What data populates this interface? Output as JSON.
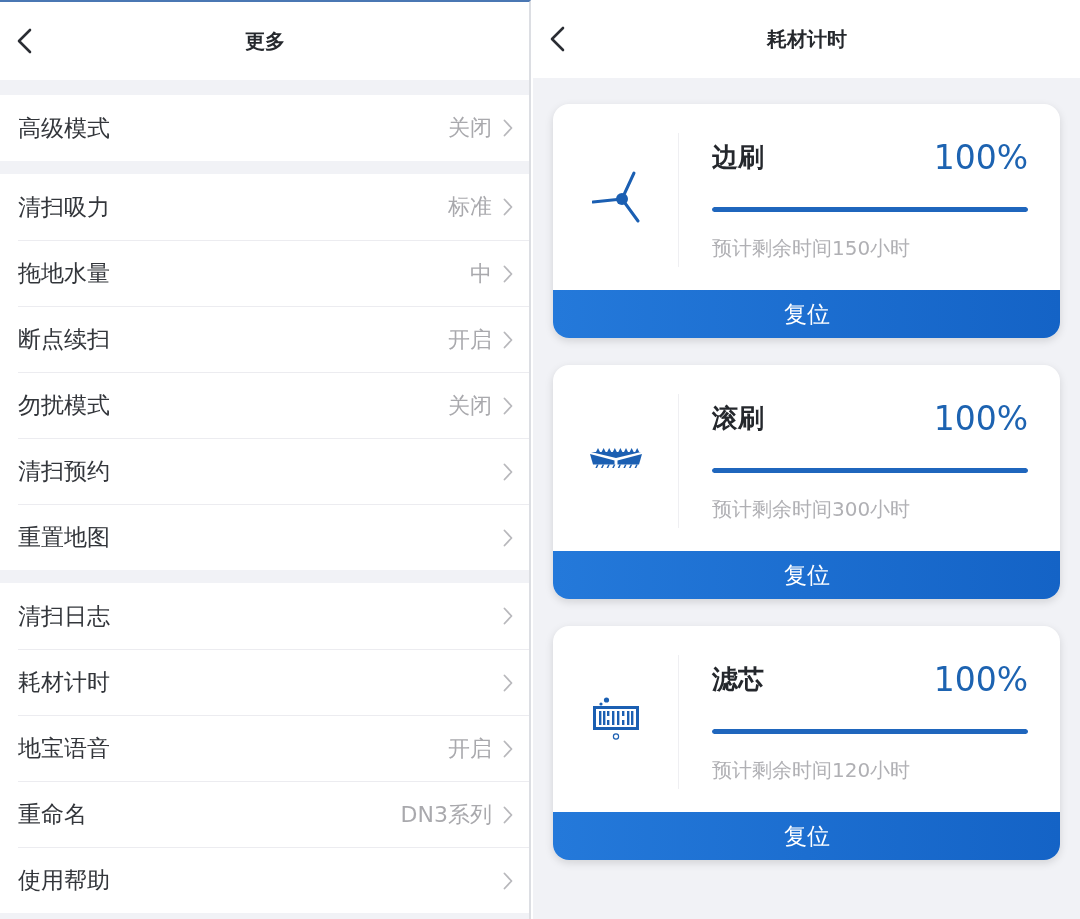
{
  "more_screen": {
    "title": "更多",
    "groups": [
      {
        "items": [
          {
            "label": "高级模式",
            "value": "关闭"
          }
        ]
      },
      {
        "items": [
          {
            "label": "清扫吸力",
            "value": "标准"
          },
          {
            "label": "拖地水量",
            "value": "中"
          },
          {
            "label": "断点续扫",
            "value": "开启"
          },
          {
            "label": "勿扰模式",
            "value": "关闭"
          },
          {
            "label": "清扫预约"
          },
          {
            "label": "重置地图"
          }
        ]
      },
      {
        "items": [
          {
            "label": "清扫日志"
          },
          {
            "label": "耗材计时"
          },
          {
            "label": "地宝语音",
            "value": "开启"
          },
          {
            "label": "重命名",
            "value": "DN3系列"
          },
          {
            "label": "使用帮助"
          }
        ]
      }
    ]
  },
  "consumables_screen": {
    "title": "耗材计时",
    "items": [
      {
        "kind": "side_brush",
        "name": "边刷",
        "percent": "100%",
        "level": 1,
        "remaining": "预计剩余时间150小时",
        "button": "复位"
      },
      {
        "kind": "roller_brush",
        "name": "滚刷",
        "percent": "100%",
        "level": 1,
        "remaining": "预计剩余时间300小时",
        "button": "复位"
      },
      {
        "kind": "filter",
        "name": "滤芯",
        "percent": "100%",
        "level": 1,
        "remaining": "预计剩余时间120小时",
        "button": "复位"
      }
    ]
  }
}
